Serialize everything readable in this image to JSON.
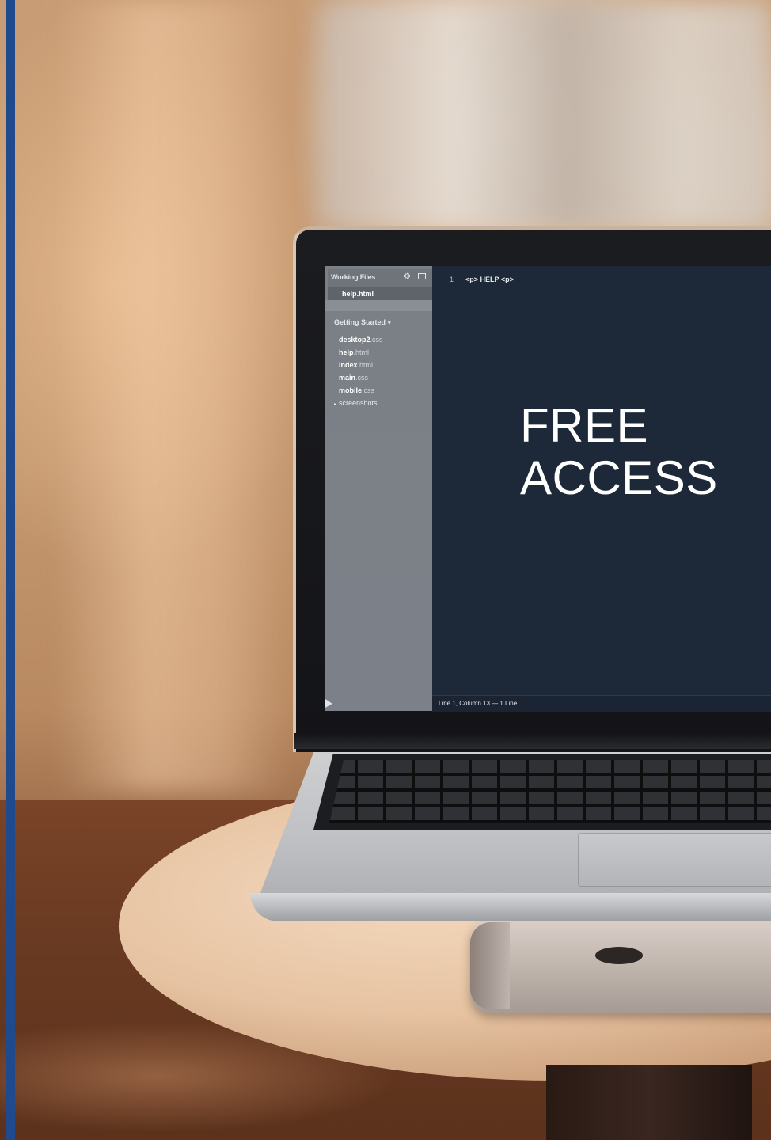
{
  "overlay": {
    "headline": "FREE ACCESS"
  },
  "editor": {
    "sidebar_title": "Working Files",
    "active_file": "help.html",
    "group_label": "Getting Started",
    "files": [
      {
        "name": "desktop2",
        "ext": ".css"
      },
      {
        "name": "help",
        "ext": ".html"
      },
      {
        "name": "index",
        "ext": ".html"
      },
      {
        "name": "main",
        "ext": ".css"
      },
      {
        "name": "mobile",
        "ext": ".css"
      }
    ],
    "folder": "screenshots",
    "line_number": "1",
    "code": "<p> HELP <p>",
    "status": "Line 1, Column 13 — 1 Line"
  },
  "colors": {
    "accent_bar": "#1f4b8e",
    "headline": "#ffffff",
    "editor_bg": "#1d2838",
    "sidebar_bg": "#7b7f86"
  },
  "icons": [
    "gear-icon",
    "split-view-icon",
    "caret-down-icon",
    "caret-right-icon",
    "mouse-cursor-icon"
  ]
}
